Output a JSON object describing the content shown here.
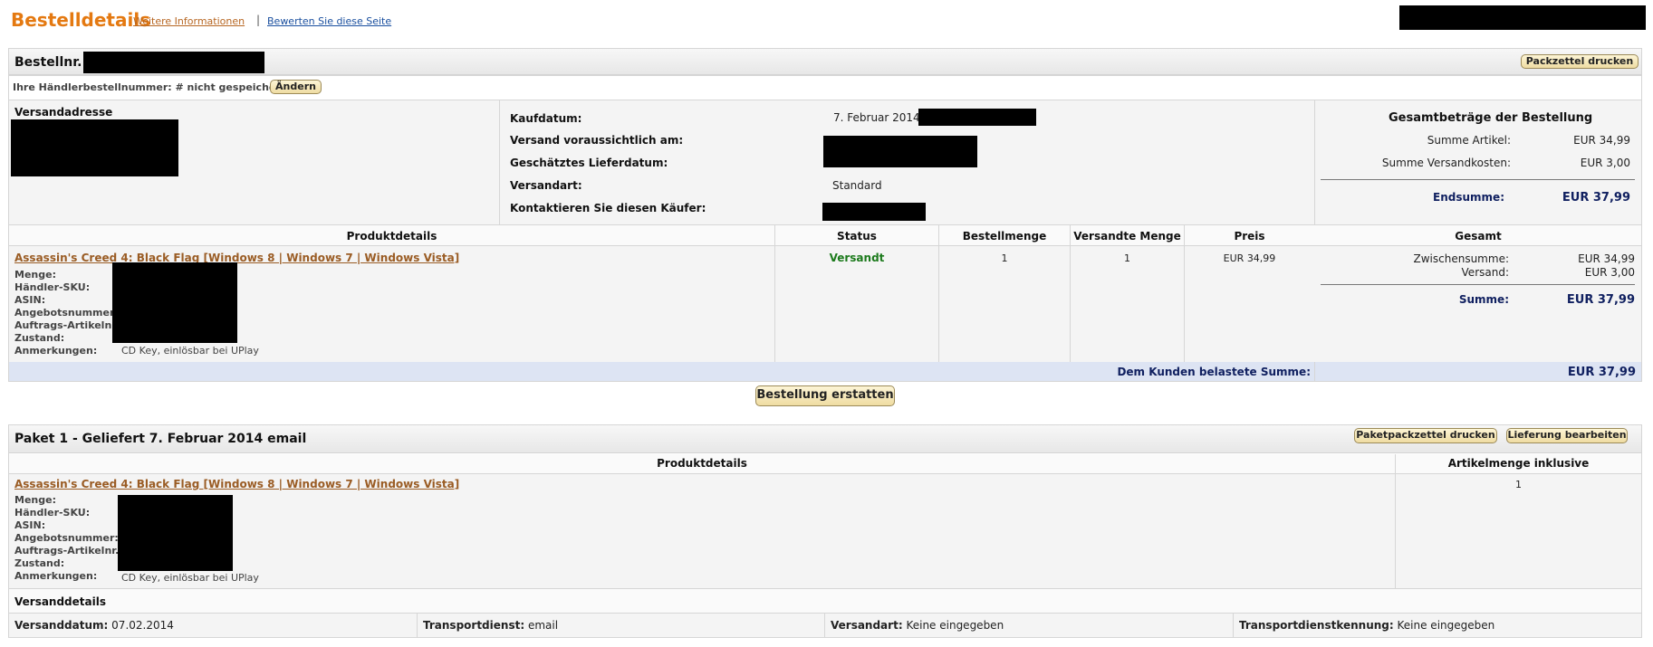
{
  "header": {
    "title": "Bestelldetails",
    "more_info_link": "Weitere Informationen",
    "separator": "|",
    "rate_link": "Bewerten Sie diese Seite"
  },
  "order": {
    "number_label": "Bestellnr.:",
    "print_button": "Packzettel drucken",
    "merchant_order_label": "Ihre Händlerbestellnummer: # nicht gespeichert",
    "change_button": "Ändern",
    "shipping_address_label": "Versandadresse",
    "fields": [
      {
        "label": "Kaufdatum:",
        "value": "7. Februar 2014"
      },
      {
        "label": "Versand voraussichtlich am:",
        "value": ""
      },
      {
        "label": "Geschätztes Lieferdatum:",
        "value": ""
      },
      {
        "label": "Versandart:",
        "value": "Standard"
      },
      {
        "label": "Kontaktieren Sie diesen Käufer:",
        "value": ""
      }
    ],
    "totals": {
      "title": "Gesamtbeträge der Bestellung",
      "items_label": "Summe Artikel:",
      "items_value": "EUR 34,99",
      "shipping_label": "Summe Versandkosten:",
      "shipping_value": "EUR 3,00",
      "total_label": "Endsumme:",
      "total_value": "EUR 37,99"
    }
  },
  "items_table": {
    "columns": [
      "Produktdetails",
      "Status",
      "Bestellmenge",
      "Versandte Menge",
      "Preis",
      "Gesamt"
    ],
    "product_title": "Assassin's Creed 4: Black Flag [Windows 8 | Windows 7 | Windows Vista]",
    "detail_labels": [
      "Menge:",
      "Händler-SKU:",
      "ASIN:",
      "Angebotsnummer:",
      "Auftrags-Artikelnr.:",
      "Zustand:",
      "Anmerkungen:"
    ],
    "note_value": "CD Key, einlösbar bei UPlay",
    "status": "Versandt",
    "ordered_qty": "1",
    "shipped_qty": "1",
    "price": "EUR 34,99",
    "subtotal_label": "Zwischensumme:",
    "subtotal_value": "EUR 34,99",
    "shipping_label": "Versand:",
    "shipping_value": "EUR 3,00",
    "sum_label": "Summe:",
    "sum_value": "EUR 37,99",
    "charged_label": "Dem Kunden belastete Summe:",
    "charged_value": "EUR 37,99"
  },
  "refund_button": "Bestellung erstatten",
  "package": {
    "title": "Paket 1 - Geliefert 7. Februar 2014 email",
    "print_button": "Paketpackzettel drucken",
    "edit_button": "Lieferung bearbeiten",
    "columns": [
      "Produktdetails",
      "Artikelmenge inklusive"
    ],
    "product_title": "Assassin's Creed 4: Black Flag [Windows 8 | Windows 7 | Windows Vista]",
    "detail_labels": [
      "Menge:",
      "Händler-SKU:",
      "ASIN:",
      "Angebotsnummer:",
      "Auftrags-Artikelnr.:",
      "Zustand:",
      "Anmerkungen:"
    ],
    "note_value": "CD Key, einlösbar bei UPlay",
    "qty": "1",
    "shipping_details_label": "Versanddetails",
    "ship_date_label": "Versanddatum:",
    "ship_date_value": "07.02.2014",
    "carrier_label": "Transportdienst:",
    "carrier_value": "email",
    "method_label": "Versandart:",
    "method_value": "Keine eingegeben",
    "tracking_label": "Transportdienstkennung:",
    "tracking_value": "Keine eingegeben"
  }
}
